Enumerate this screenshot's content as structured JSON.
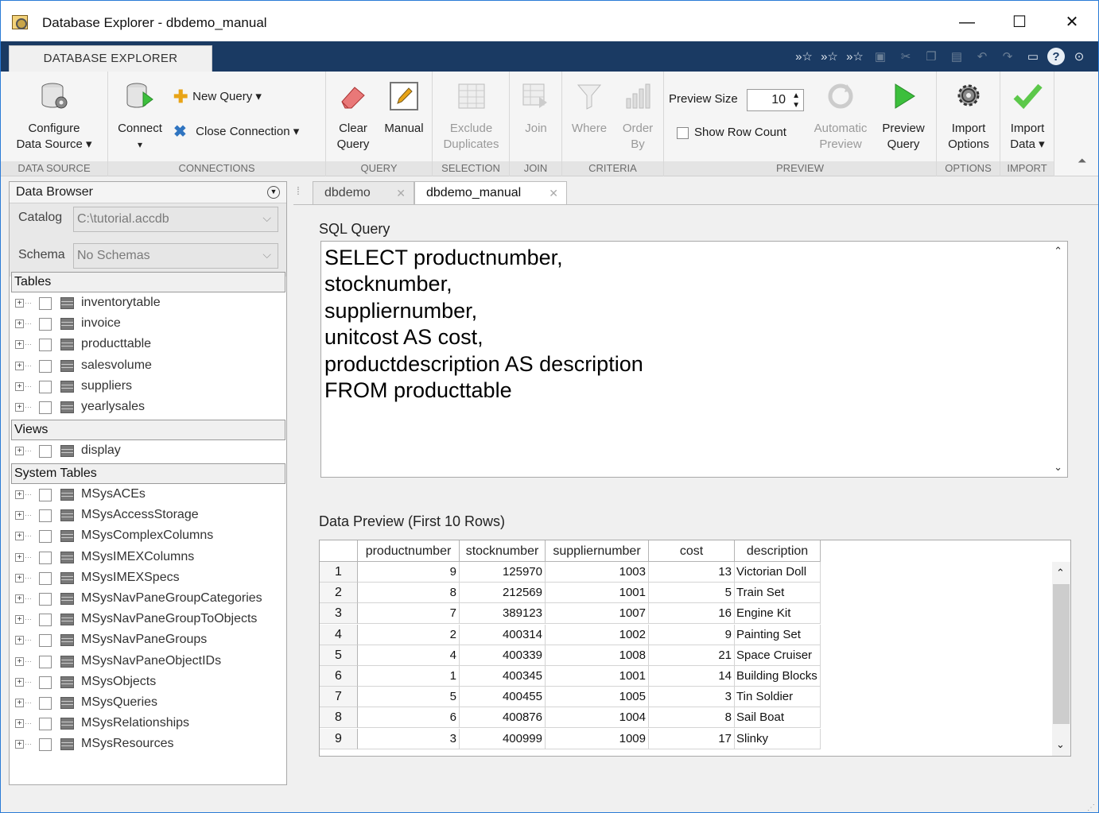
{
  "window": {
    "title": "Database Explorer - dbdemo_manual",
    "minimize_glyph": "—",
    "maximize_glyph": "☐",
    "close_glyph": "✕"
  },
  "ribbon": {
    "tab_label": "DATABASE EXPLORER",
    "groups": {
      "data_source": "DATA SOURCE",
      "connections": "CONNECTIONS",
      "query": "QUERY",
      "selection": "SELECTION",
      "join": "JOIN",
      "criteria": "CRITERIA",
      "preview": "PREVIEW",
      "options": "OPTIONS",
      "import": "IMPORT"
    },
    "buttons": {
      "configure": "Configure",
      "data_source": "Data Source ▾",
      "connect": "Connect",
      "connect_arrow": "▾",
      "new_query": "New Query  ▾",
      "close_connection": "Close Connection  ▾",
      "clear": "Clear",
      "query": "Query",
      "manual": "Manual",
      "exclude": "Exclude",
      "duplicates": "Duplicates",
      "join": "Join",
      "where": "Where",
      "order": "Order",
      "by": "By",
      "preview_size_label": "Preview Size",
      "preview_size_value": "10",
      "show_row_count": "Show Row Count",
      "automatic": "Automatic",
      "preview": "Preview",
      "preview_q1": "Preview",
      "preview_q2": "Query",
      "import": "Import",
      "options": "Options",
      "import_data1": "Import",
      "import_data2": "Data ▾"
    }
  },
  "browser": {
    "title": "Data Browser",
    "catalog_label": "Catalog",
    "catalog_value": "C:\\tutorial.accdb",
    "schema_label": "Schema",
    "schema_value": "No Schemas",
    "sections": {
      "tables": "Tables",
      "views": "Views",
      "system": "System Tables"
    },
    "tables": [
      "inventorytable",
      "invoice",
      "producttable",
      "salesvolume",
      "suppliers",
      "yearlysales"
    ],
    "views": [
      "display"
    ],
    "system_tables": [
      "MSysACEs",
      "MSysAccessStorage",
      "MSysComplexColumns",
      "MSysIMEXColumns",
      "MSysIMEXSpecs",
      "MSysNavPaneGroupCategories",
      "MSysNavPaneGroupToObjects",
      "MSysNavPaneGroups",
      "MSysNavPaneObjectIDs",
      "MSysObjects",
      "MSysQueries",
      "MSysRelationships",
      "MSysResources"
    ]
  },
  "tabs": [
    {
      "label": "dbdemo"
    },
    {
      "label": "dbdemo_manual"
    }
  ],
  "sql": {
    "header": "SQL Query",
    "text": "SELECT productnumber,\nstocknumber,\nsuppliernumber,\nunitcost AS cost,\nproductdescription AS description\nFROM producttable"
  },
  "preview": {
    "header": "Data Preview (First 10 Rows)",
    "columns": [
      "productnumber",
      "stocknumber",
      "suppliernumber",
      "cost",
      "description"
    ],
    "rows": [
      [
        "1",
        "9",
        "125970",
        "1003",
        "13",
        "Victorian Doll"
      ],
      [
        "2",
        "8",
        "212569",
        "1001",
        "5",
        "Train Set"
      ],
      [
        "3",
        "7",
        "389123",
        "1007",
        "16",
        "Engine Kit"
      ],
      [
        "4",
        "2",
        "400314",
        "1002",
        "9",
        "Painting Set"
      ],
      [
        "5",
        "4",
        "400339",
        "1008",
        "21",
        "Space Cruiser"
      ],
      [
        "6",
        "1",
        "400345",
        "1001",
        "14",
        "Building Blocks"
      ],
      [
        "7",
        "5",
        "400455",
        "1005",
        "3",
        "Tin Soldier"
      ],
      [
        "8",
        "6",
        "400876",
        "1004",
        "8",
        "Sail Boat"
      ],
      [
        "9",
        "3",
        "400999",
        "1009",
        "17",
        "Slinky"
      ]
    ]
  },
  "colors": {
    "ribbon_dark": "#1a3a63",
    "preview_green": "#3cbf3c",
    "check_green": "#5cc84a"
  }
}
